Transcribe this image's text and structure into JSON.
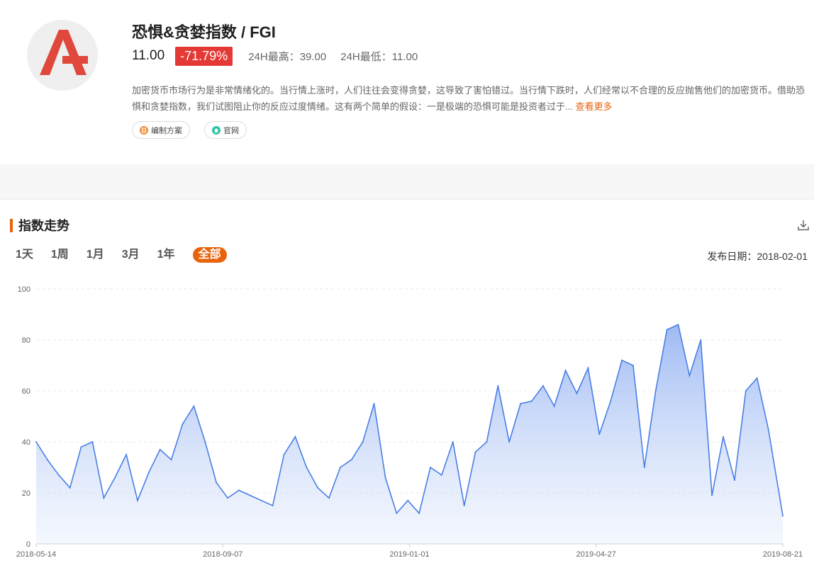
{
  "header": {
    "title": "恐惧&贪婪指数 / FGI",
    "price": "11.00",
    "change": "-71.79%",
    "high_24h": "24H最高：39.00",
    "low_24h": "24H最低：11.00",
    "description": "加密货币市场行为是非常情绪化的。当行情上涨时，人们往往会变得贪婪，这导致了害怕错过。当行情下跌时，人们经常以不合理的反应抛售他们的加密货币。借助恐惧和贪婪指数，我们试图阻止你的反应过度情绪。这有两个简单的假设：一是极端的恐惧可能是投资者过于...",
    "more_link": "查看更多",
    "tags": [
      {
        "label": "编制方案",
        "icon": "document-icon",
        "color": "#f08c3a"
      },
      {
        "label": "官网",
        "icon": "home-icon",
        "color": "#2ec4a6"
      }
    ]
  },
  "section": {
    "title": "指数走势",
    "ranges": [
      "1天",
      "1周",
      "1月",
      "3月",
      "1年",
      "全部"
    ],
    "active_range": "全部",
    "publish_date": "发布日期：2018-02-01"
  },
  "colors": {
    "accent": "#e8640c",
    "negative": "#e53935",
    "line": "#4a7fe6"
  },
  "chart_data": {
    "type": "area",
    "x_tick_labels": [
      "2018-05-14",
      "2018-09-07",
      "2019-01-01",
      "2019-04-27",
      "2019-08-21"
    ],
    "y_tick_labels": [
      "0",
      "20",
      "40",
      "60",
      "80",
      "100"
    ],
    "ylim": [
      0,
      100
    ],
    "x": [
      "2018-05-14",
      "2018-05-21",
      "2018-05-28",
      "2018-06-04",
      "2018-06-11",
      "2018-06-18",
      "2018-06-25",
      "2018-07-02",
      "2018-07-09",
      "2018-07-16",
      "2018-07-23",
      "2018-07-30",
      "2018-08-06",
      "2018-08-13",
      "2018-08-20",
      "2018-08-27",
      "2018-09-03",
      "2018-09-10",
      "2018-09-17",
      "2018-09-24",
      "2018-10-01",
      "2018-10-08",
      "2018-10-15",
      "2018-10-22",
      "2018-10-29",
      "2018-11-05",
      "2018-11-12",
      "2018-11-19",
      "2018-11-26",
      "2018-12-03",
      "2018-12-10",
      "2018-12-17",
      "2018-12-24",
      "2018-12-31",
      "2019-01-07",
      "2019-01-14",
      "2019-01-21",
      "2019-01-28",
      "2019-02-04",
      "2019-02-11",
      "2019-02-18",
      "2019-02-25",
      "2019-03-04",
      "2019-03-11",
      "2019-03-18",
      "2019-03-25",
      "2019-04-01",
      "2019-04-08",
      "2019-04-15",
      "2019-04-22",
      "2019-04-29",
      "2019-05-06",
      "2019-05-13",
      "2019-05-20",
      "2019-05-27",
      "2019-06-03",
      "2019-06-10",
      "2019-06-17",
      "2019-06-24",
      "2019-07-01",
      "2019-07-08",
      "2019-07-15",
      "2019-07-22",
      "2019-07-29",
      "2019-08-05",
      "2019-08-12",
      "2019-08-21"
    ],
    "values": [
      40,
      33,
      27,
      22,
      38,
      40,
      18,
      26,
      35,
      17,
      28,
      37,
      33,
      47,
      54,
      40,
      24,
      18,
      21,
      19,
      17,
      15,
      35,
      42,
      30,
      22,
      18,
      30,
      33,
      40,
      55,
      26,
      12,
      17,
      12,
      30,
      27,
      40,
      15,
      36,
      40,
      62,
      40,
      55,
      56,
      62,
      54,
      68,
      59,
      69,
      43,
      56,
      72,
      70,
      30,
      60,
      84,
      86,
      66,
      80,
      19,
      42,
      25,
      60,
      65,
      45,
      11
    ]
  }
}
